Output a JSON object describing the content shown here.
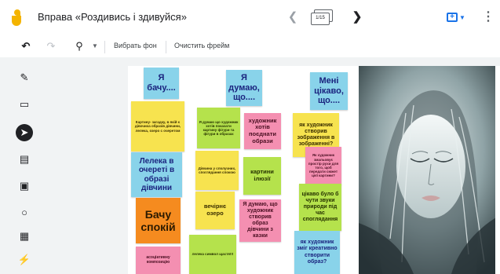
{
  "header": {
    "title": "Вправа «Роздивись і здивуйся»",
    "frame_counter": "1/15"
  },
  "toolbar": {
    "bg_label": "Вибрать фон",
    "clear_label": "Очистить фрейм"
  },
  "icons": {
    "logo": "jamboard-logo",
    "prev": "chevron-left-icon",
    "next": "chevron-right-icon",
    "frames": "frames-icon",
    "share": "share-icon",
    "more": "more-vert-icon",
    "undo": "undo-icon",
    "redo": "redo-icon",
    "zoom": "zoom-icon",
    "tools": [
      "pen-icon",
      "eraser-icon",
      "select-icon",
      "sticky-note-icon",
      "image-icon",
      "circle-icon",
      "text-box-icon",
      "laser-icon"
    ]
  },
  "colors": {
    "blue": "#89d3ea",
    "yellow": "#f7e34f",
    "green": "#b5e24c",
    "pink": "#f48fb1",
    "orange": "#f58b1f",
    "accent": "#1a73e8"
  },
  "notes": {
    "n1": "Я бачу....",
    "n2": "Я думаю, що....",
    "n3": "Мені цікаво, що....",
    "n4": "Картину- загадку, в якій є дівочиха образів дівчини, лелека, озеро с очеретом",
    "n5": "Я думаю що художник хотів показати картину фігури та фігури в образах",
    "n6": "художник хотів поєднати образи",
    "n7": "як художник створив зображення в зображенні?",
    "n8": "Як художник змальовує простір рухи для того, щоб передати сюжет цієї картини?",
    "n9": "Лелека в очереті в образі дівчини",
    "n10": "Дівчина у сполучних, споглядання спокою",
    "n11": "картини ілюзії",
    "n12": "Бачу спокій",
    "n13": "вечірнє озеро",
    "n14": "Я думаю, що художник створив образ дівчини з казки",
    "n15": "цікаво було б чути звуки природи під час споглядання",
    "n16": "як художник зміг креативно створити образ?",
    "n17": "асоціативну композицію",
    "n18": "лелека символ щастя!!!"
  }
}
